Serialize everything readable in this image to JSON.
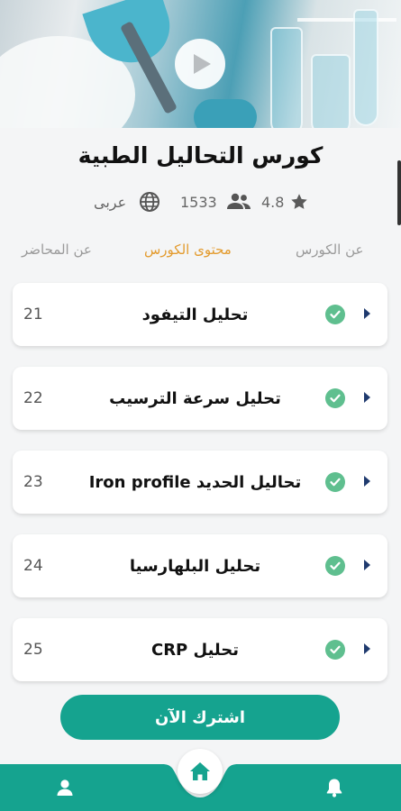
{
  "course": {
    "title": "كورس التحاليل الطبية",
    "rating": "4.8",
    "students": "1533",
    "language": "عربى"
  },
  "tabs": {
    "about": "عن الكورس",
    "content": "محتوى الكورس",
    "lecturer": "عن المحاضر",
    "active": "content"
  },
  "lessons": [
    {
      "number": "21",
      "title": "تحليل التيفود",
      "completed": true
    },
    {
      "number": "22",
      "title": "تحليل سرعة الترسيب",
      "completed": true
    },
    {
      "number": "23",
      "title": "تحاليل الحديد Iron profile",
      "completed": true
    },
    {
      "number": "24",
      "title": "تحليل البلهارسيا",
      "completed": true
    },
    {
      "number": "25",
      "title": "تحليل CRP",
      "completed": true
    }
  ],
  "subscribe_label": "اشترك الآن",
  "icons": {
    "play": "play-icon",
    "star": "star-icon",
    "students": "people-icon",
    "language": "globe-icon",
    "completed": "check-circle-icon",
    "expand": "chevron-right-icon",
    "home": "home-icon",
    "profile": "person-icon",
    "notifications": "bell-icon"
  },
  "colors": {
    "accent": "#15a38f",
    "active_tab": "#e39b2e",
    "check": "#5fbf8f",
    "arrow": "#1f3a6e"
  }
}
